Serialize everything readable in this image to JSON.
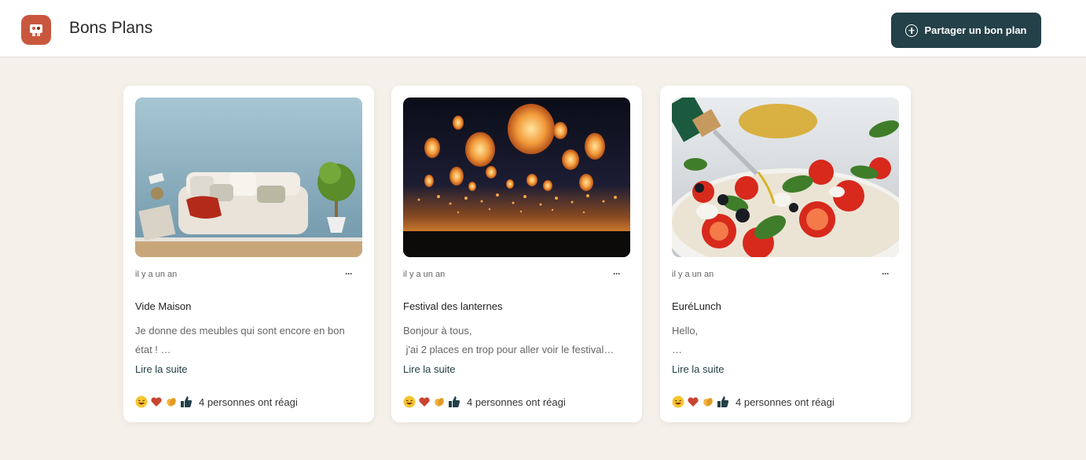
{
  "header": {
    "app_title": "Bons Plans",
    "share_button": "Partager un bon plan",
    "share_icon": "plus-circle-icon",
    "logo_icon": "app-logo-icon"
  },
  "colors": {
    "background": "#f5f0e9",
    "accent": "#244048",
    "logo": "#c9573e"
  },
  "reaction_icons": [
    "laughing-face-icon",
    "heart-icon",
    "clapping-hands-icon",
    "thumbs-up-icon"
  ],
  "cards": [
    {
      "image": "floating-sofa-photo",
      "time": "il y a un an",
      "menu": "···",
      "title": "Vide Maison",
      "excerpt_1": "Je donne des meubles qui sont encore en bon",
      "excerpt_2": "état ! …",
      "read_more": "Lire la suite",
      "reactions_text": "4 personnes ont réagi"
    },
    {
      "image": "sky-lanterns-photo",
      "time": "il y a un an",
      "menu": "···",
      "title": "Festival des lanternes",
      "excerpt_1": "Bonjour à tous,",
      "excerpt_2": " j'ai 2 places en trop pour aller voir le festival…",
      "read_more": "Lire la suite",
      "reactions_text": "4 personnes ont réagi"
    },
    {
      "image": "caprese-salad-photo",
      "time": "il y a un an",
      "menu": "···",
      "title": "EuréLunch",
      "excerpt_1": "Hello,",
      "excerpt_2": "…",
      "read_more": "Lire la suite",
      "reactions_text": "4 personnes ont réagi"
    }
  ]
}
